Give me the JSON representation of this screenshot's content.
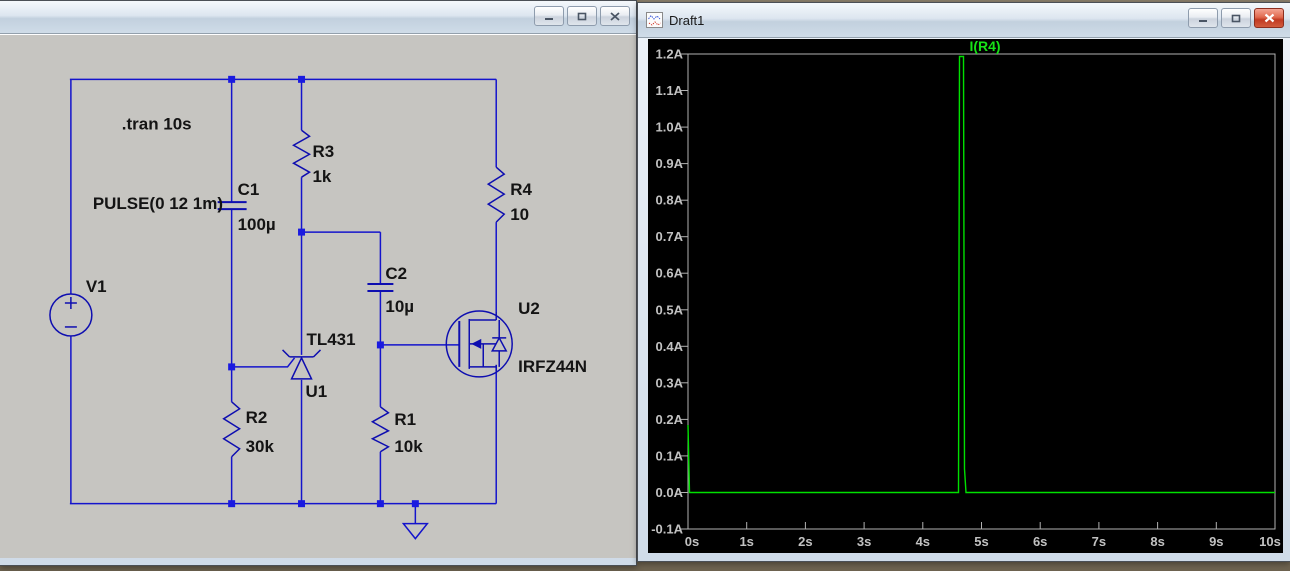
{
  "schematic_window": {
    "title": "",
    "directive": ".tran 10s",
    "components": {
      "v1": {
        "ref": "V1",
        "value": "PULSE(0 12 1m)"
      },
      "c1": {
        "ref": "C1",
        "value": "100µ"
      },
      "r2": {
        "ref": "R2",
        "value": "30k"
      },
      "r3": {
        "ref": "R3",
        "value": "1k"
      },
      "u1": {
        "ref": "U1",
        "value": "TL431"
      },
      "c2": {
        "ref": "C2",
        "value": "10µ"
      },
      "r1": {
        "ref": "R1",
        "value": "10k"
      },
      "r4": {
        "ref": "R4",
        "value": "10"
      },
      "u2": {
        "ref": "U2",
        "value": "IRFZ44N"
      }
    }
  },
  "plot_window": {
    "title": "Draft1",
    "trace_label": "I(R4)",
    "y_ticks": [
      "1.2A",
      "1.1A",
      "1.0A",
      "0.9A",
      "0.8A",
      "0.7A",
      "0.6A",
      "0.5A",
      "0.4A",
      "0.3A",
      "0.2A",
      "0.1A",
      "0.0A",
      "-0.1A"
    ],
    "x_ticks": [
      "0s",
      "1s",
      "2s",
      "3s",
      "4s",
      "5s",
      "6s",
      "7s",
      "8s",
      "9s",
      "10s"
    ]
  },
  "chart_data": {
    "type": "line",
    "title": "",
    "xlabel": "",
    "ylabel": "",
    "xlim": [
      0,
      10
    ],
    "ylim": [
      -0.1,
      1.2
    ],
    "x_tick_labels": [
      "0s",
      "1s",
      "2s",
      "3s",
      "4s",
      "5s",
      "6s",
      "7s",
      "8s",
      "9s",
      "10s"
    ],
    "y_tick_labels": [
      "1.2A",
      "1.1A",
      "1.0A",
      "0.9A",
      "0.8A",
      "0.7A",
      "0.6A",
      "0.5A",
      "0.4A",
      "0.3A",
      "0.2A",
      "0.1A",
      "0.0A",
      "-0.1A"
    ],
    "grid": false,
    "background": "#000000",
    "legend_position": "top-center",
    "series": [
      {
        "name": "I(R4)",
        "color": "#00e000",
        "points": [
          [
            0,
            0.19
          ],
          [
            0.03,
            0.0
          ],
          [
            4.6,
            0.0
          ],
          [
            4.62,
            1.2
          ],
          [
            4.7,
            1.2
          ],
          [
            4.73,
            0.05
          ],
          [
            4.75,
            0.0
          ],
          [
            10,
            0.0
          ]
        ]
      }
    ]
  },
  "colors": {
    "wire_blue": "#1414cc",
    "symbol_navy": "#0e0eb0",
    "junction_blue": "#1a1ae0",
    "trace_green": "#00e000",
    "plot_frame_gray": "#b2b2b2",
    "schematic_bg": "#c6c5c1",
    "plot_bg": "#000000"
  }
}
